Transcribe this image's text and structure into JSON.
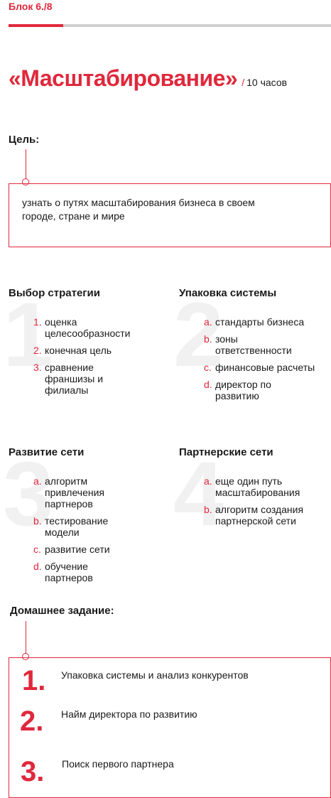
{
  "block_label": "Блок 6./8",
  "progress_fraction": 0.17,
  "title": "«Масштабирование»",
  "hours_separator": "/",
  "hours": "10 часов",
  "goal": {
    "label": "Цель:",
    "text_line1": "узнать о путях масштабирования бизнеса в своем",
    "text_line2": "городе, стране и мире"
  },
  "sections": [
    {
      "number": "1",
      "title": "Выбор стратегии",
      "items": [
        {
          "marker": "1.",
          "lines": [
            "оценка",
            "целесообразности"
          ]
        },
        {
          "marker": "2.",
          "lines": [
            "конечная цель"
          ]
        },
        {
          "marker": "3.",
          "lines": [
            "сравнение",
            "франшизы и",
            "филиалы"
          ]
        }
      ]
    },
    {
      "number": "2",
      "title": "Упаковка системы",
      "items": [
        {
          "marker": "a.",
          "lines": [
            "стандарты бизнеса"
          ]
        },
        {
          "marker": "b.",
          "lines": [
            "зоны",
            "ответственности"
          ]
        },
        {
          "marker": "c.",
          "lines": [
            "финансовые расчеты"
          ]
        },
        {
          "marker": "d.",
          "lines": [
            "директор по",
            "развитию"
          ]
        }
      ]
    },
    {
      "number": "3",
      "title": "Развитие сети",
      "items": [
        {
          "marker": "a.",
          "lines": [
            "алгоритм",
            "привлечения",
            "партнеров"
          ]
        },
        {
          "marker": "b.",
          "lines": [
            "тестирование",
            "модели"
          ]
        },
        {
          "marker": "c.",
          "lines": [
            "развитие сети"
          ]
        },
        {
          "marker": "d.",
          "lines": [
            "обучение",
            "партнеров"
          ]
        }
      ]
    },
    {
      "number": "4",
      "title": "Партнерские сети",
      "items": [
        {
          "marker": "a.",
          "lines": [
            "еще один путь",
            "масштабирования"
          ]
        },
        {
          "marker": "b.",
          "lines": [
            "алгоритм создания",
            "партнерской сети"
          ]
        }
      ]
    }
  ],
  "homework": {
    "label": "Домашнее задание:",
    "items": [
      {
        "number": "1.",
        "text": "Упаковка системы и анализ конкурентов"
      },
      {
        "number": "2.",
        "text": "Найм директора по развитию"
      },
      {
        "number": "3.",
        "text": "Поиск первого партнера"
      }
    ]
  },
  "colors": {
    "accent": "#e0283c",
    "progress_track": "#cfcfcf",
    "watermark_number": "#f1f1f1"
  }
}
